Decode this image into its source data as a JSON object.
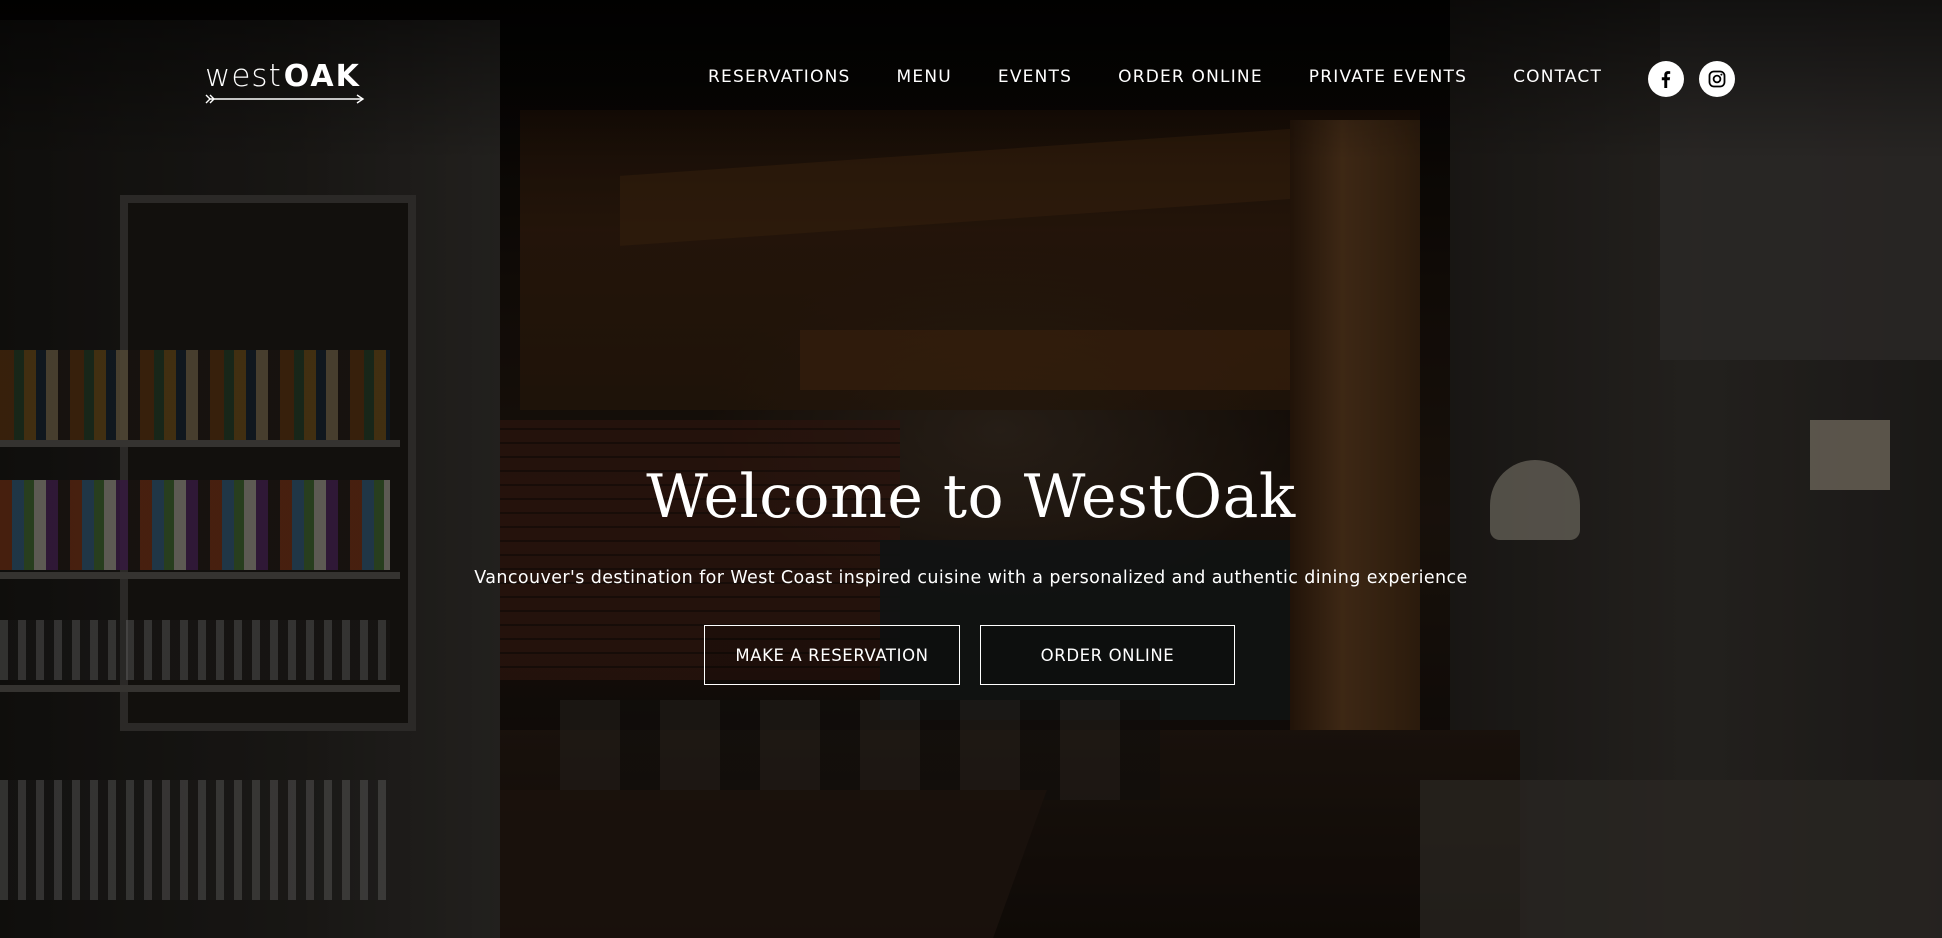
{
  "brand": {
    "logo_light": "west",
    "logo_bold": "OAK"
  },
  "nav": {
    "items": [
      {
        "label": "RESERVATIONS"
      },
      {
        "label": "MENU"
      },
      {
        "label": "EVENTS"
      },
      {
        "label": "ORDER ONLINE"
      },
      {
        "label": "PRIVATE EVENTS"
      },
      {
        "label": "CONTACT"
      }
    ]
  },
  "social": {
    "items": [
      {
        "icon": "facebook-icon"
      },
      {
        "icon": "instagram-icon"
      }
    ]
  },
  "hero": {
    "title": "Welcome to WestOak",
    "subtitle": "Vancouver's destination for West Coast inspired cuisine with a personalized and authentic dining experience",
    "buttons": [
      {
        "label": "MAKE A RESERVATION"
      },
      {
        "label": "ORDER ONLINE"
      }
    ]
  },
  "colors": {
    "text": "#ffffff",
    "overlay": "#000000"
  }
}
